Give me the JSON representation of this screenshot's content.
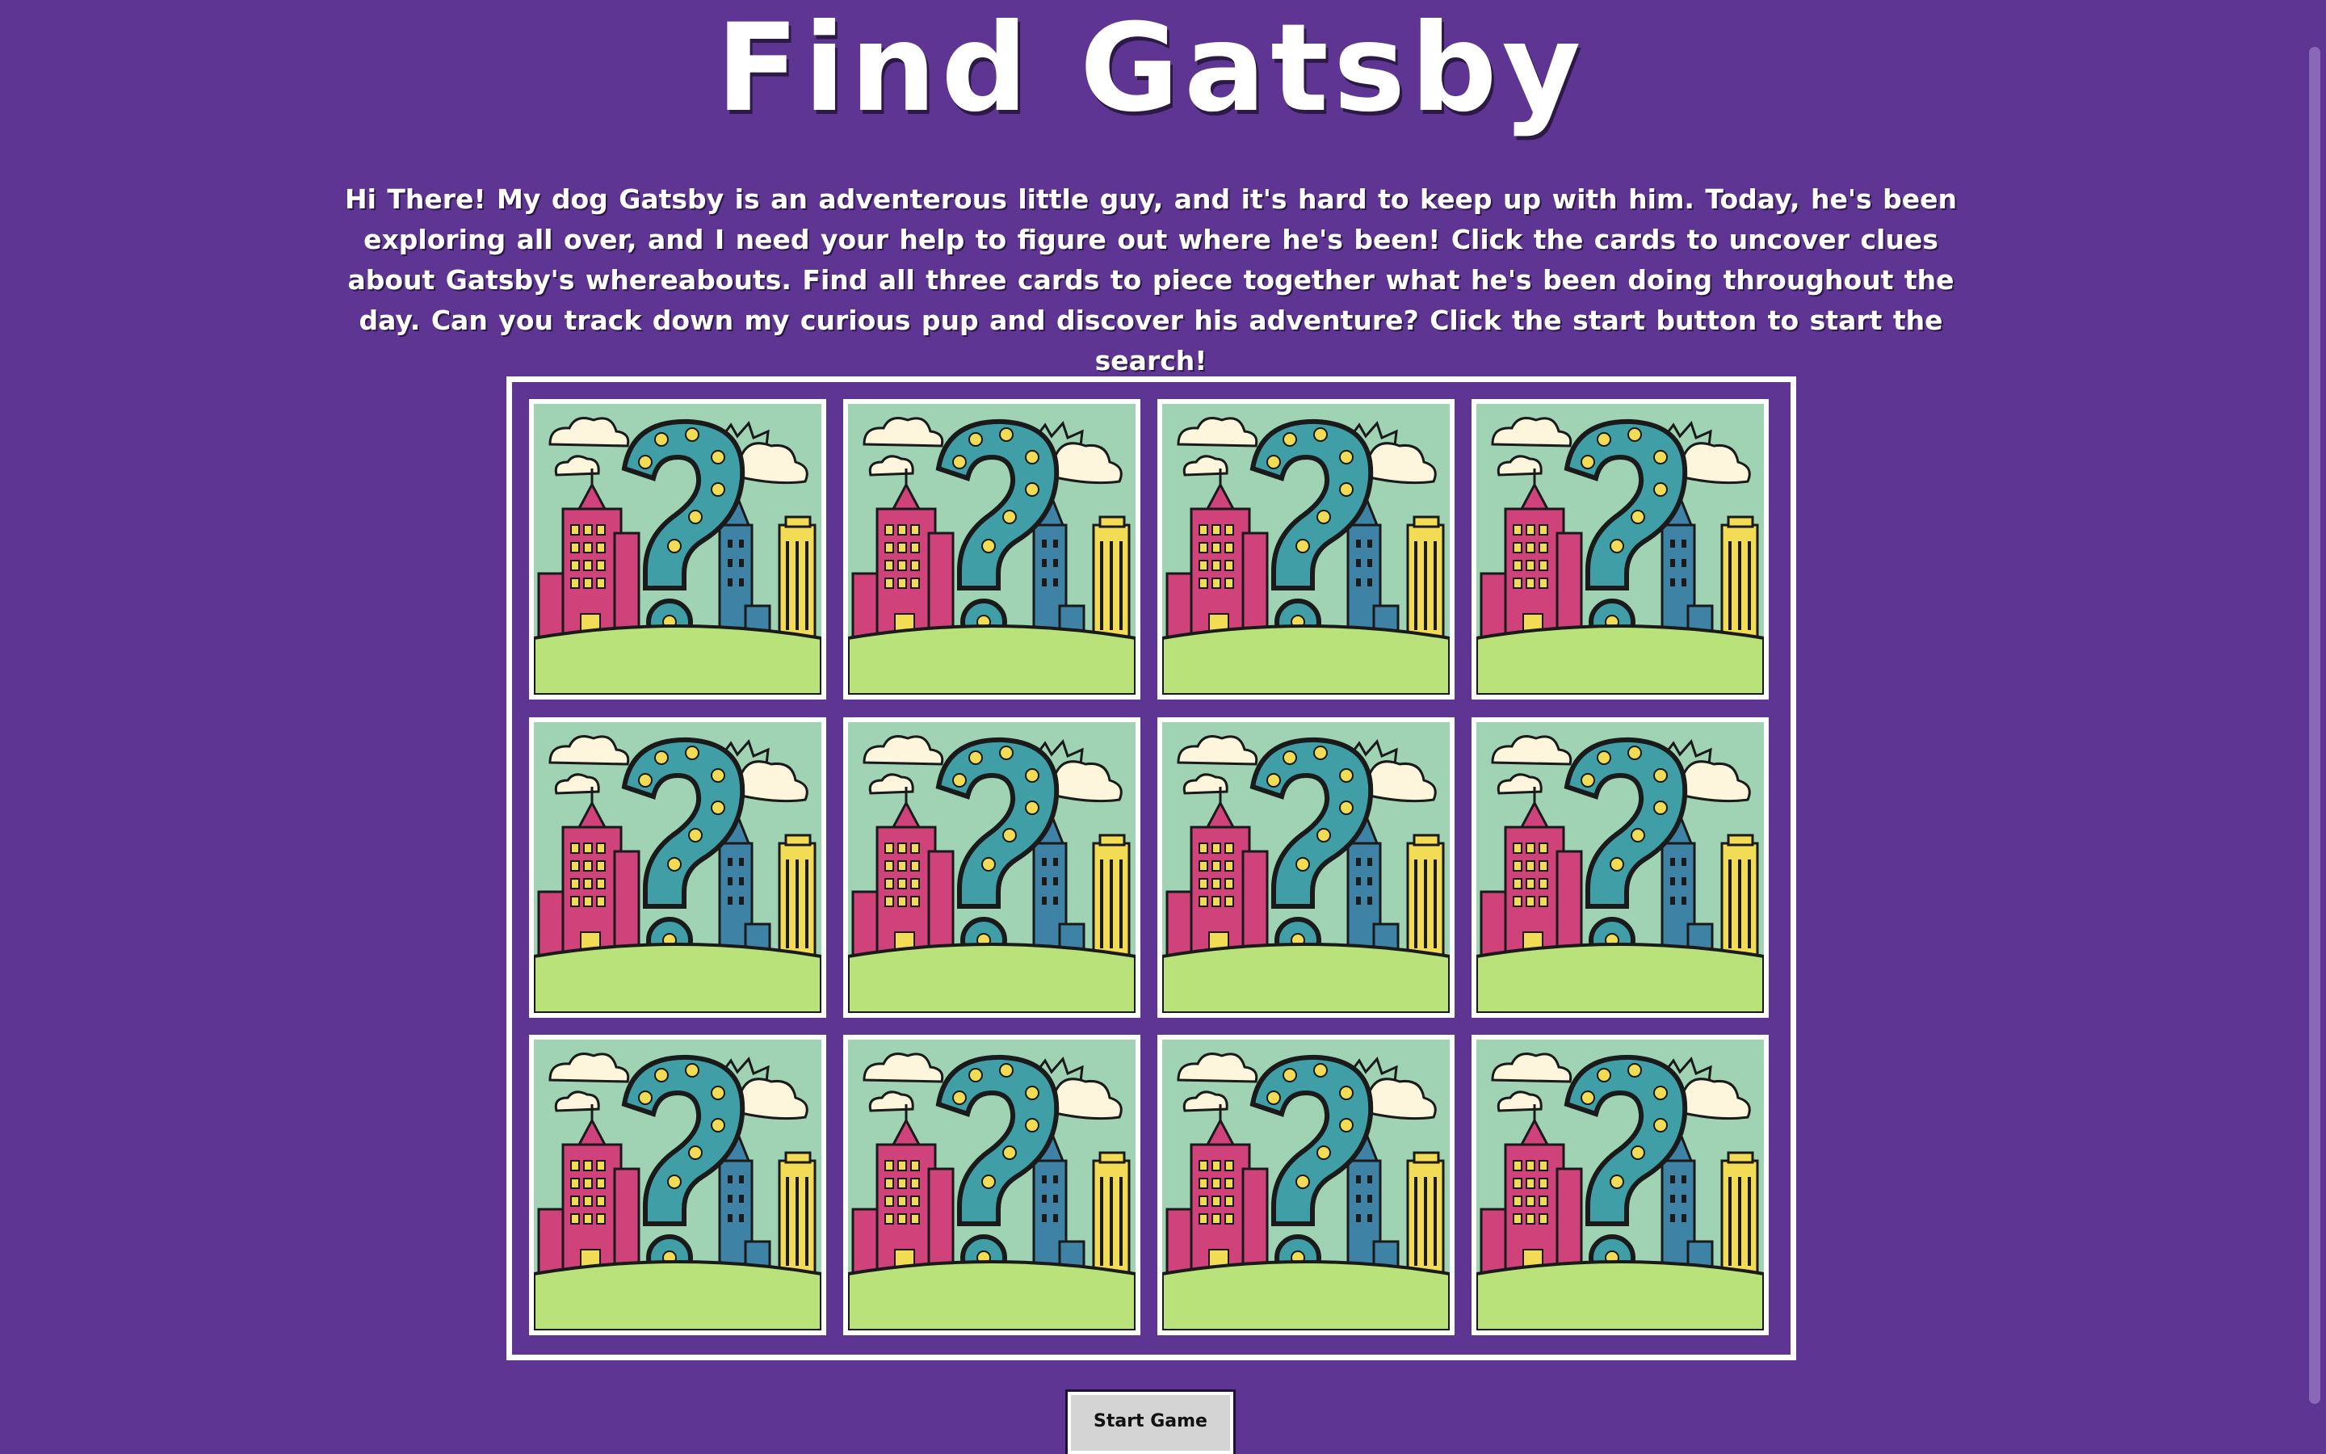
{
  "game": {
    "title": "Find Gatsby",
    "intro": "Hi There! My dog Gatsby is an adventerous little guy, and it's hard to keep up with him. Today, he's been exploring all over, and I need your help to figure out where he's been! Click the cards to uncover clues about Gatsby's whereabouts. Find all three cards to piece together what he's been doing throughout the day. Can you track down my curious pup and discover his adventure? Click the start button to start the search!",
    "start_button": "Start Game"
  },
  "cards": {
    "count": 12,
    "columns": 4,
    "state": "face-down",
    "card_back": "city-question-mark-illustration"
  },
  "colors": {
    "background": "#5e3593",
    "board_border": "#ffffff",
    "card_sky": "#9fd3b4",
    "card_ground": "#b9e27a",
    "building_pink": "#d0437a",
    "building_blue": "#3e82a6",
    "building_yellow": "#f2dc55",
    "question_mark": "#3f9ea6",
    "question_dots": "#f2dc55",
    "button_bg": "#d4d4d4"
  }
}
